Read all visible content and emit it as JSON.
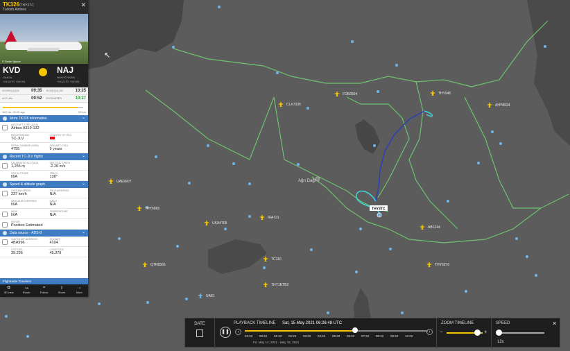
{
  "flight": {
    "callsign": "TK326",
    "callsign_suffix": "/THY3TC",
    "airline": "Turkish Airlines",
    "photo_credit": "© Dmitri Iljasov",
    "from_code": "KVD",
    "from_city": "GANJA",
    "from_tz": "+04 (UTC +04:00)",
    "to_code": "NAJ",
    "to_city": "NAKHCHIVAN",
    "to_tz": "+04 (UTC +04:00)",
    "times": {
      "scheduled_label": "SCHEDULED",
      "actual_label": "ACTUAL",
      "estimated_label": "ESTIMATED",
      "dep_scheduled": "09:35",
      "dep_actual": "09:52",
      "arr_scheduled": "10:25",
      "arr_estimated": "10:27"
    },
    "progress_left": "163 km, 00:22 ago",
    "progress_right": "59 km",
    "progress_fraction": 0.9
  },
  "sections": {
    "more_info": "More TK326 information",
    "recent": "Recent TC-JLV flights",
    "speed": "Speed & altitude graph",
    "source": "Data source - ADS-B"
  },
  "details": {
    "aircraft_type_label": "AIRCRAFT TYPE (A319)",
    "aircraft_type": "Airbus A319-132",
    "registration_label": "REGISTRATION",
    "registration": "TC-JLV",
    "country_label": "COUNTRY OF REG.",
    "serial_label": "SERIAL NUMBER (MSN)",
    "serial": "4755",
    "age_label": "AGE (MFG 2011)",
    "age": "9 years",
    "cal_alt_label": "CALIBRATED ALTITUDE",
    "cal_alt": "1,255 m",
    "vs_label": "VERTICAL SPEED",
    "vs": "-2.28 m/s",
    "gps_alt_label": "GPS ALTITUDE",
    "gps_alt": "N/A",
    "track_label": "TRACK",
    "track": "138°",
    "ground_speed_label": "GROUND SPEED",
    "ground_speed": "237 km/h",
    "true_airspeed_label": "TRUE AIRSPEED",
    "true_airspeed": "N/A",
    "ias_label": "INDICATED AIRSPEED",
    "ias": "N/A",
    "mach_label": "MACH",
    "mach": "N/A",
    "wind_label": "WIND",
    "wind": "N/A",
    "temp_label": "TEMPERATURE",
    "temp": "N/A",
    "fir_label": "FIR/UIR",
    "fir": "Position Estimated",
    "icao_label": "ICAO 24-BIT ADDRESS",
    "icao": "4BA996",
    "squawk_label": "SQUAWK",
    "squawk": "4104",
    "lat_label": "LATITUDE",
    "lat": "39.256",
    "lon_label": "LONGITUDE",
    "lon": "45.379"
  },
  "ad_text": "Flightradar  Travelers",
  "nav": [
    {
      "label": "3D view",
      "icon": "⧉"
    },
    {
      "label": "Route",
      "icon": "↝"
    },
    {
      "label": "Follow",
      "icon": "⌖"
    },
    {
      "label": "Share",
      "icon": "⇪"
    },
    {
      "label": "More",
      "icon": "⋯"
    }
  ],
  "map": {
    "place": "Ağrı Dağı",
    "selected_flight": "THY3TC",
    "aircraft": [
      "CLX7335",
      "FDB3504",
      "THY945",
      "AHY8924",
      "UAE9907",
      "THY6665",
      "UKA4705",
      "IRA721",
      "TC110",
      "AB1244",
      "QTR8566",
      "THY1KTB2",
      "THY6270",
      "UAE1"
    ]
  },
  "playback": {
    "date_label": "DATE",
    "title": "PLAYBACK TIMELINE",
    "current_time": "Sat, 15 May 2021 06:26:48 UTC",
    "ticks": [
      "23:22",
      "00:22",
      "01:22",
      "02:22",
      "03:22",
      "04:22",
      "05:22",
      "06:22",
      "07:22",
      "08:22",
      "09:22",
      "10:22"
    ],
    "range_label": "Fri, May 14, 2021 - May 15, 2021",
    "zoom_label": "ZOOM TIMELINE",
    "speed_label": "SPEED",
    "speed_value": "12x"
  },
  "colors": {
    "accent": "#f5c400",
    "section": "#3d7cc1",
    "border": "#6fcf6f",
    "track_blue": "#2a3fb8",
    "track_cyan": "#3fd6e0"
  }
}
